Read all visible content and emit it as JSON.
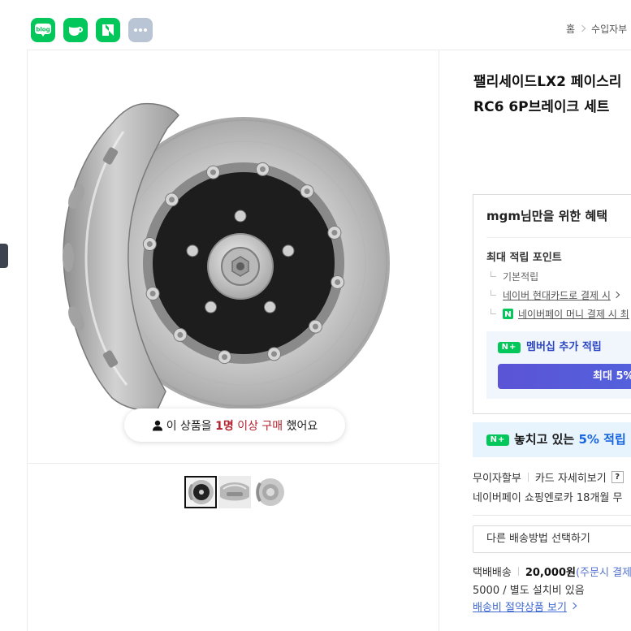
{
  "share_bar": {
    "icons": [
      {
        "icon": "naver-blog-icon",
        "text": "blog"
      },
      {
        "icon": "naver-cafe-icon"
      },
      {
        "icon": "naver-keep-icon"
      },
      {
        "icon": "more-dots-icon"
      }
    ]
  },
  "breadcrumb": {
    "home": "홈",
    "separator_icon": "chevron-right-icon",
    "category": "수입자부"
  },
  "gallery": {
    "main_image": "brake-caliper-and-rotor-photo",
    "purchase_badge": {
      "icon": "person-icon",
      "prefix": "이 상품을",
      "count": "1명",
      "emphasis": "이상 구매",
      "suffix": "했어요"
    },
    "thumbnails": [
      "rotor-front-thumbnail",
      "caliper-thumbnail",
      "rotor-side-thumbnail"
    ],
    "selected_thumbnail_index": 0
  },
  "product": {
    "title_line1": "팰리세이드LX2 페이스리",
    "title_line2": "RC6 6P브레이크 세트"
  },
  "benefits": {
    "heading": "mgm님만을 위한 혜택",
    "max_points_label": "최대 적립 포인트",
    "items": [
      {
        "label": "기본적립"
      },
      {
        "label": "네이버 현대카드로 결제 시",
        "icon": "chevron-right-icon"
      },
      {
        "label": "네이버페이 머니 결제 시 최",
        "icon": "naverpay-money-icon"
      }
    ],
    "membership": {
      "badge": "N+",
      "label": "멤버십 추가 적립",
      "button_label": "최대 5%"
    }
  },
  "missed_banner": {
    "badge": "N+",
    "text": "놓치고 있는",
    "highlight": "5% 적립"
  },
  "installment": {
    "label": "무이자할부",
    "card_link": "카드 자세히보기",
    "help": "?",
    "promo": "네이버페이 쇼핑엔로카 18개월 무"
  },
  "shipping": {
    "method_select": "다른 배송방법 선택하기",
    "type": "택배배송",
    "fee": "20,000원",
    "fee_note": "(주문시 결제",
    "extra": "5000 / 별도 설치비 있음",
    "saver_link": "배송비 절약상품 보기",
    "saver_icon": "chevron-right-icon"
  },
  "colors": {
    "naver_green": "#03c75a",
    "highlight_blue": "#1866e0",
    "badge_red": "#b1222e",
    "membership_button": "#5b54d6",
    "banner_bg": "#e7f3fd"
  }
}
